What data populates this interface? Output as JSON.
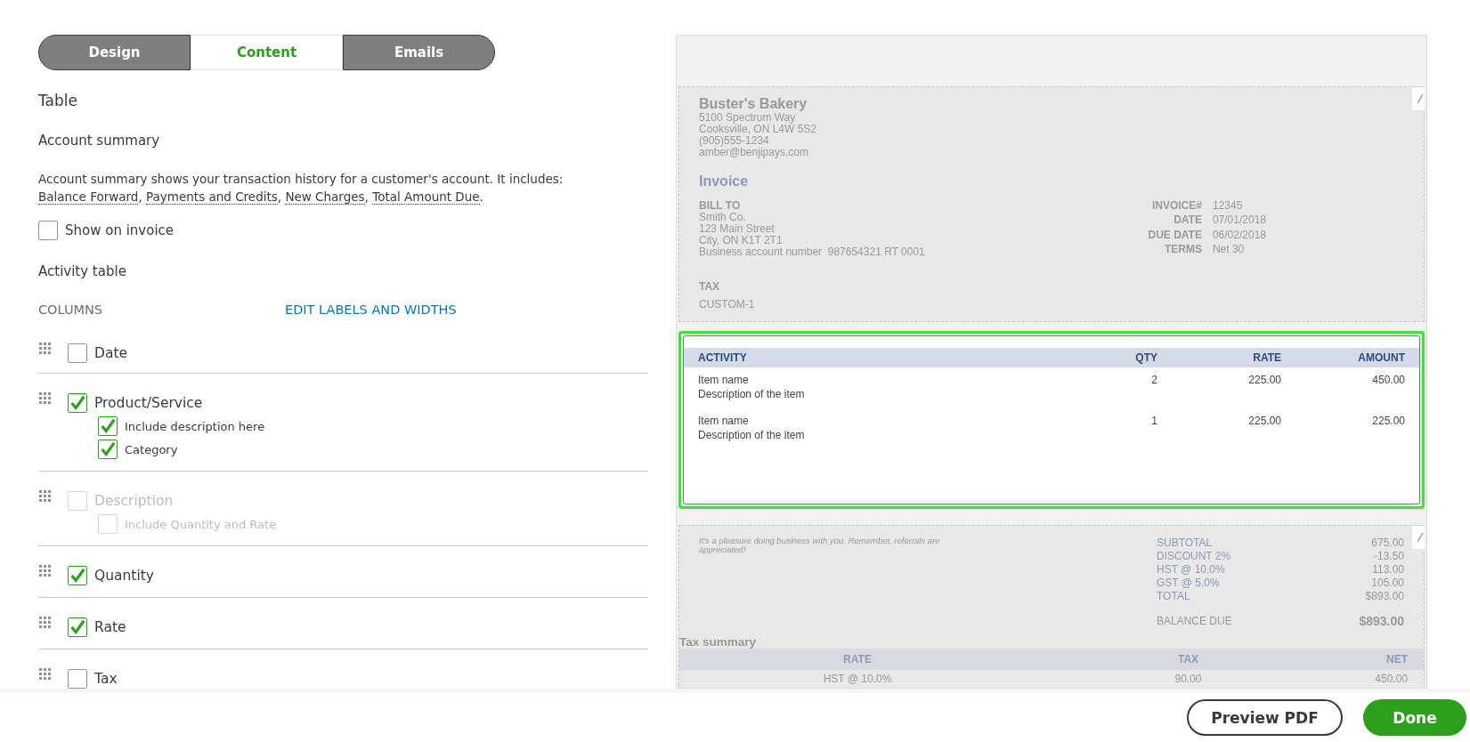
{
  "tabs": [
    {
      "label": "Design",
      "selected": false
    },
    {
      "label": "Content",
      "selected": true
    },
    {
      "label": "Emails",
      "selected": false
    }
  ],
  "section_title": "Table",
  "account_summary": {
    "title": "Account summary",
    "text": "Account summary shows your transaction history for a customer's account. It includes:",
    "links": [
      {
        "label": "Balance Forward",
        "after": ","
      },
      {
        "label": "Payments and Credits",
        "after": ","
      },
      {
        "label": "New Charges",
        "after": ","
      },
      {
        "label": "Total Amount Due",
        "after": "."
      }
    ],
    "show_on_invoice": {
      "label": "Show on invoice",
      "checked": false
    }
  },
  "activity_table": {
    "title": "Activity table",
    "columns_label": "COLUMNS",
    "edit_link": "EDIT LABELS AND WIDTHS"
  },
  "columns": [
    {
      "label": "Date",
      "checked": false,
      "disabled": false
    },
    {
      "label": "Product/Service",
      "checked": true,
      "disabled": false,
      "children": [
        {
          "label": "Include description here",
          "checked": true,
          "disabled": false
        },
        {
          "label": "Category",
          "checked": true,
          "disabled": false
        }
      ]
    },
    {
      "label": "Description",
      "checked": false,
      "disabled": true,
      "children": [
        {
          "label": "Include Quantity and Rate",
          "checked": false,
          "disabled": true
        }
      ]
    },
    {
      "label": "Quantity",
      "checked": true,
      "disabled": false
    },
    {
      "label": "Rate",
      "checked": true,
      "disabled": false
    },
    {
      "label": "Tax",
      "checked": false,
      "disabled": false
    }
  ],
  "preview": {
    "company": {
      "name": "Buster's Bakery",
      "lines": [
        "5100 Spectrum Way",
        "Cooksville, ON L4W 5S2",
        "(905)555-1234",
        "amber@benjipays.com"
      ]
    },
    "doc_title": "Invoice",
    "bill_to": {
      "heading": "BILL TO",
      "lines": [
        "Smith Co.",
        "123 Main Street",
        "City, ON K1T 2T1",
        "Business account number  987654321 RT 0001"
      ]
    },
    "meta": [
      {
        "label": "INVOICE#",
        "value": "12345"
      },
      {
        "label": "DATE",
        "value": "07/01/2018"
      },
      {
        "label": "DUE DATE",
        "value": "06/02/2018"
      },
      {
        "label": "TERMS",
        "value": "Net 30"
      }
    ],
    "tax": {
      "heading": "TAX",
      "value": "CUSTOM-1"
    },
    "table": {
      "highlighted": true,
      "columns": [
        "ACTIVITY",
        "QTY",
        "RATE",
        "AMOUNT"
      ],
      "rows": [
        {
          "activity": "Item name",
          "description": "Description of the item",
          "qty": "2",
          "rate": "225.00",
          "amount": "450.00"
        },
        {
          "activity": "Item name",
          "description": "Description of the item",
          "qty": "1",
          "rate": "225.00",
          "amount": "225.00"
        }
      ]
    },
    "message": "It's a pleasure doing business with you. Remember, referrals are appreciated!",
    "totals": [
      {
        "label": "SUBTOTAL",
        "value": "675.00"
      },
      {
        "label": "DISCOUNT 2%",
        "value": "-13.50"
      },
      {
        "label": "HST @ 10.0%",
        "value": "113.00"
      },
      {
        "label": "GST @ 5.0%",
        "value": "105.00"
      },
      {
        "label": "TOTAL",
        "value": "$893.00"
      }
    ],
    "balance": {
      "label": "BALANCE DUE",
      "value": "$893.00"
    },
    "tax_summary": {
      "title": "Tax summary",
      "columns": [
        "RATE",
        "TAX",
        "NET"
      ],
      "rows": [
        [
          "HST @ 10.0%",
          "90.00",
          "450.00"
        ]
      ]
    }
  },
  "buttons": [
    {
      "label": "Preview PDF",
      "kind": "secondary"
    },
    {
      "label": "Done",
      "kind": "primary"
    }
  ]
}
